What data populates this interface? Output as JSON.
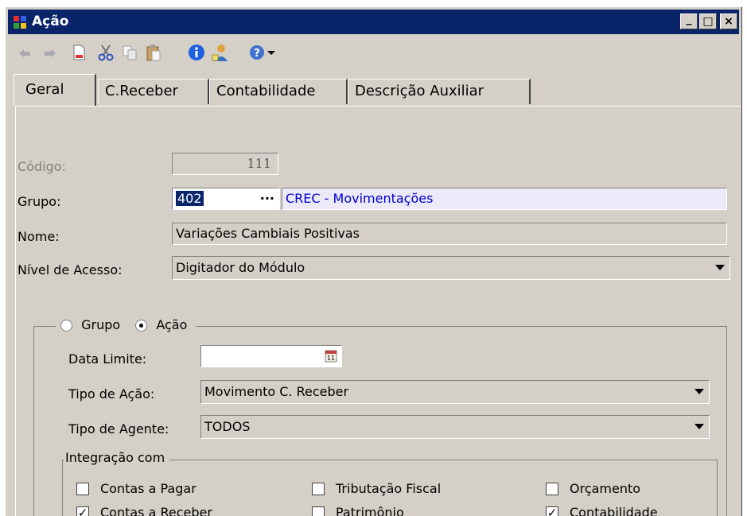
{
  "window": {
    "title": "Ação",
    "minimize": "_",
    "maximize": "□",
    "close": "×"
  },
  "tabs": [
    {
      "label": "Geral"
    },
    {
      "label": "C.Receber"
    },
    {
      "label": "Contabilidade"
    },
    {
      "label": "Descrição Auxiliar"
    }
  ],
  "form": {
    "codigo_label": "Código:",
    "codigo_value": "111",
    "grupo_label": "Grupo:",
    "grupo_code": "402",
    "grupo_lookup": "···",
    "grupo_desc": "CREC - Movimentações",
    "nome_label": "Nome:",
    "nome_value": "Variações Cambiais Positivas",
    "nivel_label": "Nível de Acesso:",
    "nivel_value": "Digitador do Módulo"
  },
  "group": {
    "radio_grupo": "Grupo",
    "radio_acao": "Ação",
    "selected": "Ação",
    "data_limite_label": "Data Limite:",
    "data_limite_value": "",
    "tipo_acao_label": "Tipo de Ação:",
    "tipo_acao_value": "Movimento C. Receber",
    "tipo_agente_label": "Tipo de Agente:",
    "tipo_agente_value": "TODOS"
  },
  "integracao": {
    "title": "Integração com",
    "items": [
      {
        "label": "Contas a Pagar",
        "checked": false
      },
      {
        "label": "Tributação Fiscal",
        "checked": false
      },
      {
        "label": "Orçamento",
        "checked": false
      },
      {
        "label": "Contas a Receber",
        "checked": true
      },
      {
        "label": "Patrimônio",
        "checked": false
      },
      {
        "label": "Contabilidade",
        "checked": true
      }
    ]
  },
  "colors": {
    "titlebar": "#0a246a",
    "face": "#d4d0c8",
    "link_blue": "#0000cc"
  }
}
